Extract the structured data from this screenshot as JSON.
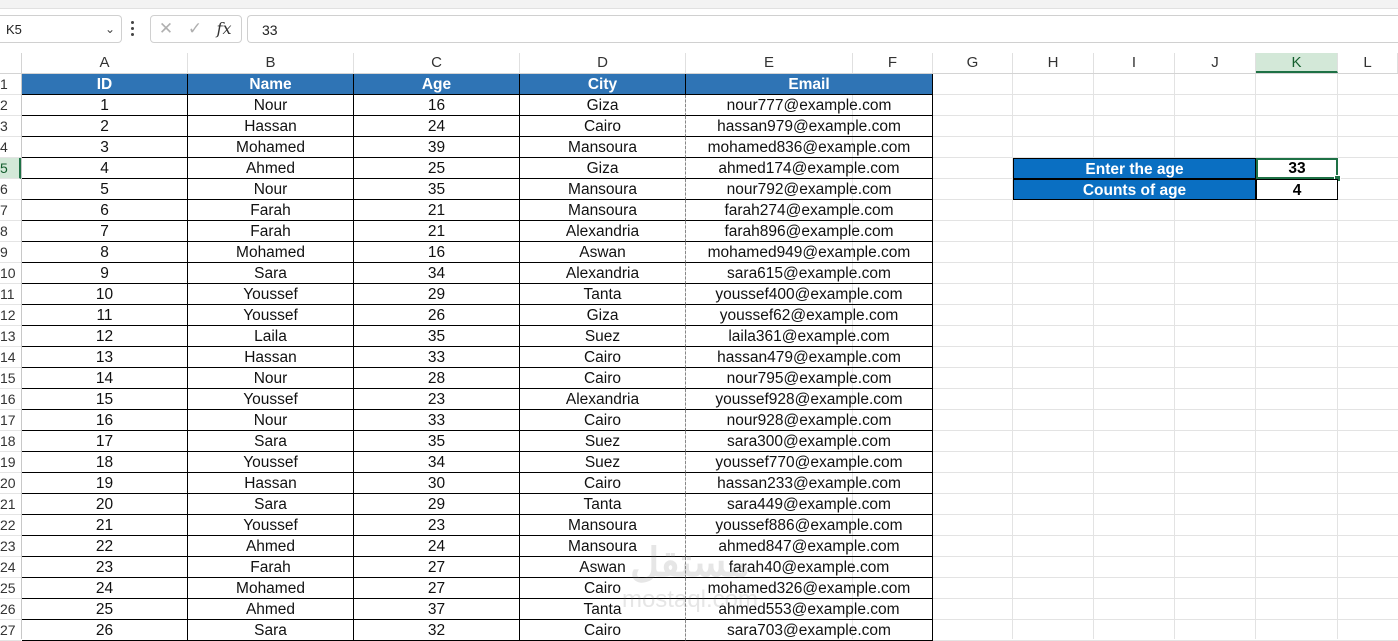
{
  "formula_bar": {
    "name_box": "K5",
    "formula": "33",
    "cancel_icon": "close-icon",
    "enter_icon": "check-icon",
    "fx_label": "fx"
  },
  "columns": [
    "A",
    "B",
    "C",
    "D",
    "E",
    "F",
    "G",
    "H",
    "I",
    "J",
    "K",
    "L"
  ],
  "selected_column": "K",
  "selected_row": "5",
  "rows": [
    "1",
    "2",
    "3",
    "4",
    "5",
    "6",
    "7",
    "8",
    "9",
    "10",
    "11",
    "12",
    "13",
    "14",
    "15",
    "16",
    "17",
    "18",
    "19",
    "20",
    "21",
    "22",
    "23",
    "24",
    "25",
    "26",
    "27"
  ],
  "table": {
    "headers": [
      "ID",
      "Name",
      "Age",
      "City",
      "Email"
    ],
    "data": [
      [
        "1",
        "Nour",
        "16",
        "Giza",
        "nour777@example.com"
      ],
      [
        "2",
        "Hassan",
        "24",
        "Cairo",
        "hassan979@example.com"
      ],
      [
        "3",
        "Mohamed",
        "39",
        "Mansoura",
        "mohamed836@example.com"
      ],
      [
        "4",
        "Ahmed",
        "25",
        "Giza",
        "ahmed174@example.com"
      ],
      [
        "5",
        "Nour",
        "35",
        "Mansoura",
        "nour792@example.com"
      ],
      [
        "6",
        "Farah",
        "21",
        "Mansoura",
        "farah274@example.com"
      ],
      [
        "7",
        "Farah",
        "21",
        "Alexandria",
        "farah896@example.com"
      ],
      [
        "8",
        "Mohamed",
        "16",
        "Aswan",
        "mohamed949@example.com"
      ],
      [
        "9",
        "Sara",
        "34",
        "Alexandria",
        "sara615@example.com"
      ],
      [
        "10",
        "Youssef",
        "29",
        "Tanta",
        "youssef400@example.com"
      ],
      [
        "11",
        "Youssef",
        "26",
        "Giza",
        "youssef62@example.com"
      ],
      [
        "12",
        "Laila",
        "35",
        "Suez",
        "laila361@example.com"
      ],
      [
        "13",
        "Hassan",
        "33",
        "Cairo",
        "hassan479@example.com"
      ],
      [
        "14",
        "Nour",
        "28",
        "Cairo",
        "nour795@example.com"
      ],
      [
        "15",
        "Youssef",
        "23",
        "Alexandria",
        "youssef928@example.com"
      ],
      [
        "16",
        "Nour",
        "33",
        "Cairo",
        "nour928@example.com"
      ],
      [
        "17",
        "Sara",
        "35",
        "Suez",
        "sara300@example.com"
      ],
      [
        "18",
        "Youssef",
        "34",
        "Suez",
        "youssef770@example.com"
      ],
      [
        "19",
        "Hassan",
        "30",
        "Cairo",
        "hassan233@example.com"
      ],
      [
        "20",
        "Sara",
        "29",
        "Tanta",
        "sara449@example.com"
      ],
      [
        "21",
        "Youssef",
        "23",
        "Mansoura",
        "youssef886@example.com"
      ],
      [
        "22",
        "Ahmed",
        "24",
        "Mansoura",
        "ahmed847@example.com"
      ],
      [
        "23",
        "Farah",
        "27",
        "Aswan",
        "farah40@example.com"
      ],
      [
        "24",
        "Mohamed",
        "27",
        "Cairo",
        "mohamed326@example.com"
      ],
      [
        "25",
        "Ahmed",
        "37",
        "Tanta",
        "ahmed553@example.com"
      ],
      [
        "26",
        "Sara",
        "32",
        "Cairo",
        "sara703@example.com"
      ]
    ]
  },
  "lookup": {
    "enter_label": "Enter the age",
    "enter_value": "33",
    "count_label": "Counts of age",
    "count_value": "4"
  },
  "watermark": {
    "arabic": "مستقل",
    "latin": "mostaql.com"
  },
  "colors": {
    "header_blue": "#2f74b5",
    "lookup_blue": "#0a6fc2",
    "selection_green": "#1e7145"
  }
}
